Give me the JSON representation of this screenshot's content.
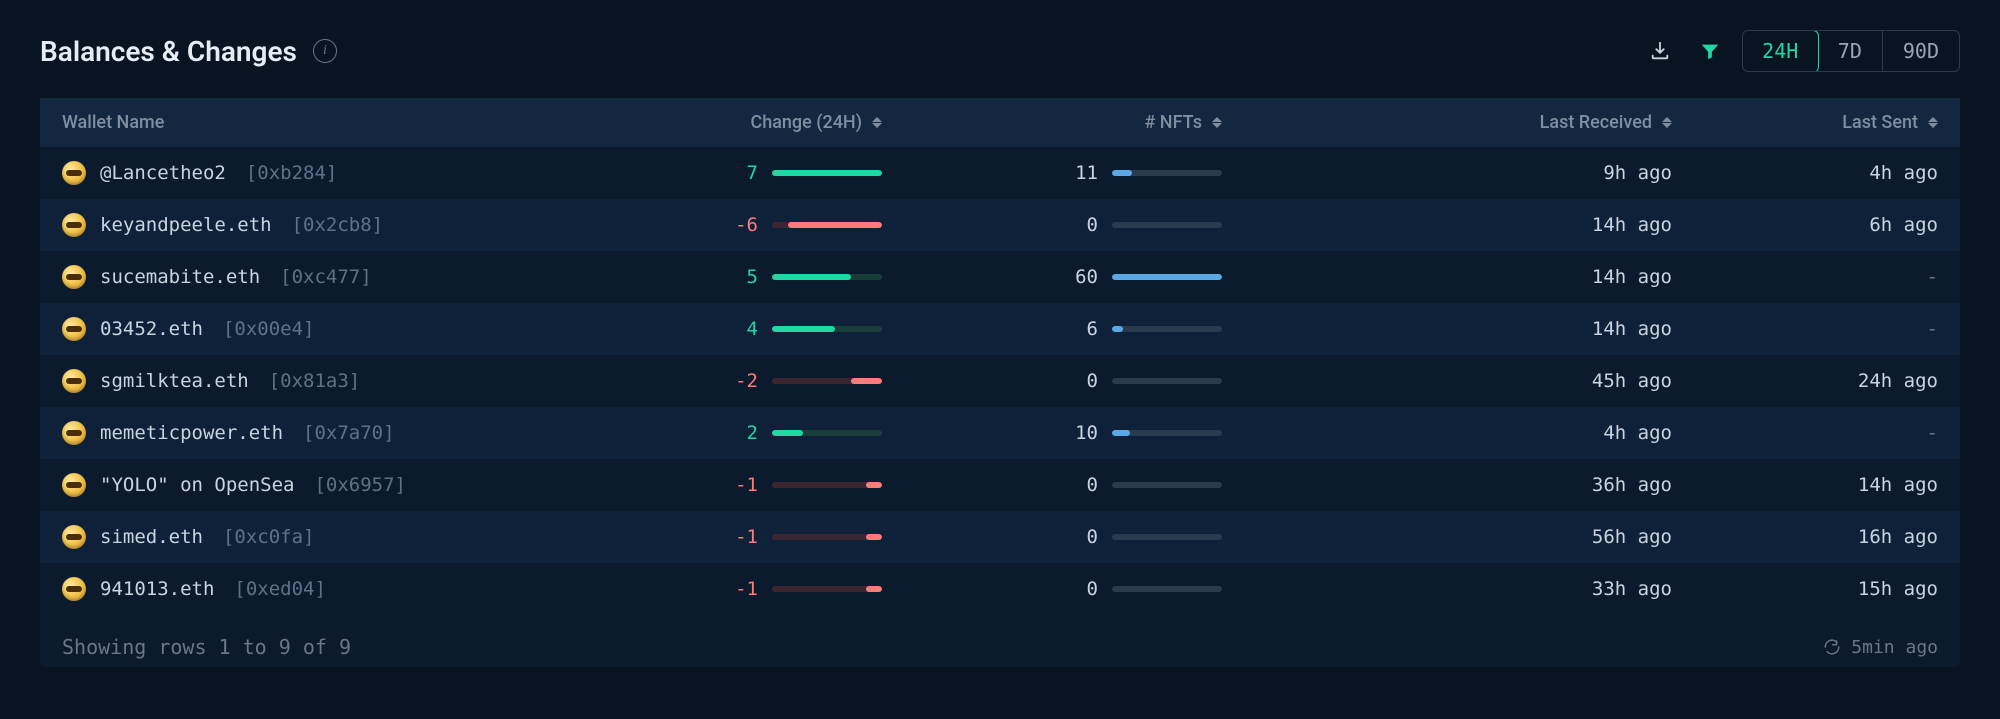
{
  "colors": {
    "accent": "#1fd8a4",
    "negative": "#ff7a7a",
    "nft": "#5aa9e6"
  },
  "header": {
    "title": "Balances & Changes"
  },
  "timeframe": {
    "options": [
      "24H",
      "7D",
      "90D"
    ],
    "active": "24H"
  },
  "columns": {
    "name": "Wallet Name",
    "change": "Change (24H)",
    "nfts": "# NFTs",
    "received": "Last Received",
    "sent": "Last Sent"
  },
  "max_change_abs": 7,
  "max_nfts": 60,
  "rows": [
    {
      "name": "@Lancetheo2",
      "hash": "[0xb284]",
      "change": 7,
      "nfts": 11,
      "received": "9h ago",
      "sent": "4h ago"
    },
    {
      "name": "keyandpeele.eth",
      "hash": "[0x2cb8]",
      "change": -6,
      "nfts": 0,
      "received": "14h ago",
      "sent": "6h ago"
    },
    {
      "name": "sucemabite.eth",
      "hash": "[0xc477]",
      "change": 5,
      "nfts": 60,
      "received": "14h ago",
      "sent": "-"
    },
    {
      "name": "03452.eth",
      "hash": "[0x00e4]",
      "change": 4,
      "nfts": 6,
      "received": "14h ago",
      "sent": "-"
    },
    {
      "name": "sgmilktea.eth",
      "hash": "[0x81a3]",
      "change": -2,
      "nfts": 0,
      "received": "45h ago",
      "sent": "24h ago"
    },
    {
      "name": "memeticpower.eth",
      "hash": "[0x7a70]",
      "change": 2,
      "nfts": 10,
      "received": "4h ago",
      "sent": "-"
    },
    {
      "name": "\"YOLO\" on OpenSea",
      "hash": "[0x6957]",
      "change": -1,
      "nfts": 0,
      "received": "36h ago",
      "sent": "14h ago"
    },
    {
      "name": "simed.eth",
      "hash": "[0xc0fa]",
      "change": -1,
      "nfts": 0,
      "received": "56h ago",
      "sent": "16h ago"
    },
    {
      "name": "941013.eth",
      "hash": "[0xed04]",
      "change": -1,
      "nfts": 0,
      "received": "33h ago",
      "sent": "15h ago"
    }
  ],
  "footer": {
    "showing": "Showing rows 1 to 9 of 9",
    "refreshed": "5min ago"
  }
}
